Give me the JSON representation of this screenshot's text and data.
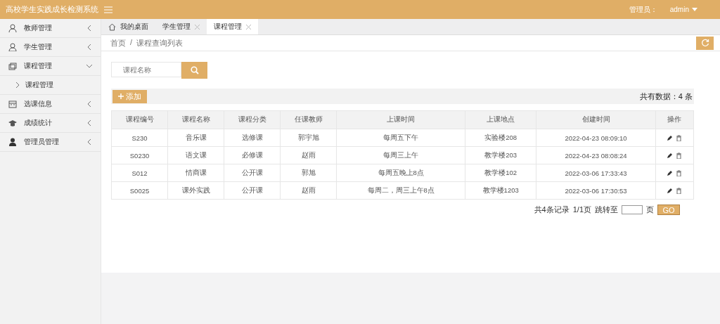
{
  "header": {
    "title": "高校学生实践成长检测系统",
    "user_label": "管理员：",
    "user_name": "admin"
  },
  "sidebar": {
    "items": [
      {
        "label": "教师管理",
        "expanded": false
      },
      {
        "label": "学生管理",
        "expanded": false
      },
      {
        "label": "课程管理",
        "expanded": true,
        "children": [
          {
            "label": "课程管理"
          }
        ]
      },
      {
        "label": "选课信息",
        "expanded": false
      },
      {
        "label": "成绩统计",
        "expanded": false
      },
      {
        "label": "管理员管理",
        "expanded": false
      }
    ]
  },
  "tabs": [
    {
      "label": "我的桌面",
      "home": true,
      "closable": false,
      "selected": false
    },
    {
      "label": "学生管理",
      "home": false,
      "closable": true,
      "selected": false
    },
    {
      "label": "课程管理",
      "home": false,
      "closable": true,
      "selected": true
    }
  ],
  "breadcrumb": {
    "separator": "/",
    "items": [
      "首页",
      "课程查询列表"
    ]
  },
  "search": {
    "placeholder": "课程名称"
  },
  "add_button": "添加",
  "total": "共有数据：4 条",
  "table": {
    "columns": [
      "课程编号",
      "课程名称",
      "课程分类",
      "任课教师",
      "上课时间",
      "上课地点",
      "创建时间",
      "操作"
    ],
    "rows": [
      [
        "S230",
        "音乐课",
        "选修课",
        "郭宇旭",
        "每周五下午",
        "实验楼208",
        "2022-04-23 08:09:10"
      ],
      [
        "S0230",
        "语文课",
        "必修课",
        "赵雨",
        "每周三上午",
        "教学楼203",
        "2022-04-23 08:08:24"
      ],
      [
        "S012",
        "情商课",
        "公开课",
        "郭旭",
        "每周五晚上8点",
        "教学楼102",
        "2022-03-06 17:33:43"
      ],
      [
        "S0025",
        "课外实践",
        "公开课",
        "赵雨",
        "每周二，周三上午8点",
        "教学楼1203",
        "2022-03-06 17:30:53"
      ]
    ]
  },
  "pagination": {
    "records": "共4条记录",
    "pages": "1/1页",
    "jump_label": "跳转至",
    "page_unit": "页",
    "go": "GO"
  }
}
